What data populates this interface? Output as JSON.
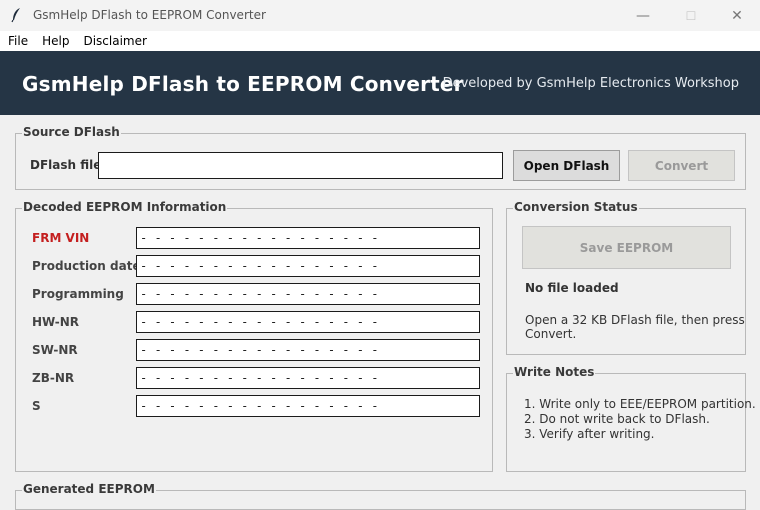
{
  "window": {
    "title": "GsmHelp DFlash to EEPROM Converter",
    "minimize": "—",
    "maximize": "☐",
    "close": "✕"
  },
  "menu": [
    "File",
    "Help",
    "Disclaimer"
  ],
  "header": {
    "title": "GsmHelp DFlash to EEPROM Converter",
    "subtitle": "Developed by GsmHelp Electronics Workshop"
  },
  "source": {
    "group_label": "Source DFlash",
    "file_label": "DFlash file",
    "file_value": "",
    "open_button": "Open DFlash",
    "convert_button": "Convert"
  },
  "decoded": {
    "group_label": "Decoded EEPROM Information",
    "fields": [
      {
        "label": "FRM VIN",
        "value": "- - - - - - - - - - - - - - - - -",
        "highlight": true
      },
      {
        "label": "Production date",
        "value": "- - - - - - - - - - - - - - - - -"
      },
      {
        "label": "Programming",
        "value": "- - - - - - - - - - - - - - - - -"
      },
      {
        "label": "HW-NR",
        "value": "- - - - - - - - - - - - - - - - -"
      },
      {
        "label": "SW-NR",
        "value": "- - - - - - - - - - - - - - - - -"
      },
      {
        "label": "ZB-NR",
        "value": "- - - - - - - - - - - - - - - - -"
      },
      {
        "label": "S",
        "value": "- - - - - - - - - - - - - - - - -"
      }
    ]
  },
  "status": {
    "group_label": "Conversion Status",
    "save_button": "Save EEPROM",
    "title": "No file loaded",
    "message_line1": "Open a 32 KB DFlash file, then press",
    "message_line2": "Convert."
  },
  "notes": {
    "group_label": "Write Notes",
    "items": [
      "1. Write only to EEE/EEPROM partition.",
      "2. Do not write back to DFlash.",
      "3. Verify after writing."
    ]
  },
  "generated": {
    "group_label": "Generated EEPROM"
  },
  "colors": {
    "header_bg": "#253545",
    "highlight_label": "#c41f1f",
    "window_bg": "#f0f0f0"
  }
}
